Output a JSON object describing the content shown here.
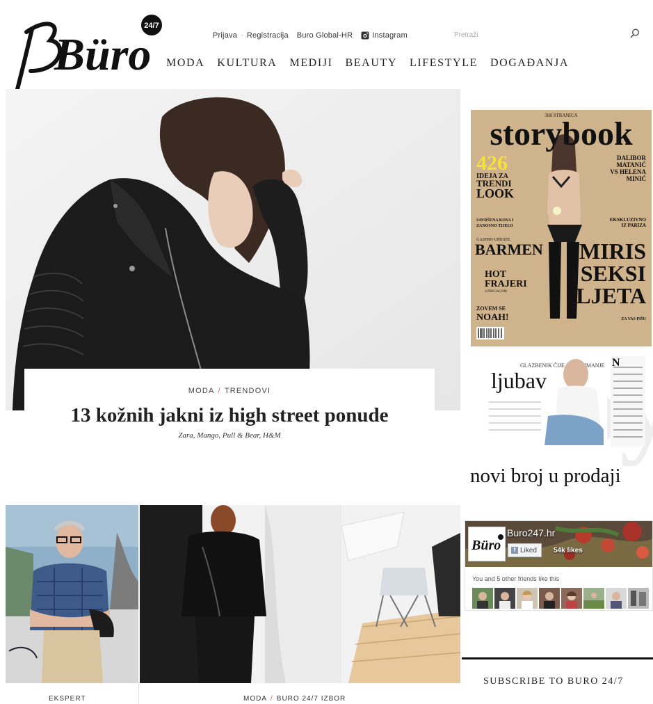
{
  "brand": {
    "logo_text": "Büro",
    "logo_badge": "24/7"
  },
  "top_links": {
    "login": "Prijava",
    "separator": "·",
    "register": "Registracija",
    "global": "Buro Global-HR",
    "instagram": "Instagram"
  },
  "search": {
    "placeholder": "Pretraži",
    "icon": "search-icon"
  },
  "nav": {
    "items": [
      "MODA",
      "KULTURA",
      "MEDIJI",
      "BEAUTY",
      "LIFESTYLE",
      "DOGAĐANJA"
    ]
  },
  "hero": {
    "category": "MODA",
    "separator": "/",
    "subcategory": "TRENDOVI",
    "title": "13 kožnih jakni iz high street ponude",
    "subtitle": "Zara, Mango, Pull & Bear, H&M"
  },
  "cards": [
    {
      "category": "EKSPERT"
    },
    {
      "category": "MODA",
      "separator": "/",
      "subcategory": "BURO 24/7 IZBOR"
    }
  ],
  "magazine": {
    "pages": "308 STRANICA",
    "title": "storybook",
    "big_number": "426",
    "left_lines": [
      "IDEJA ZA",
      "TRENDI",
      "LOOK"
    ],
    "center_line_1": "SAVRŠENA KOSA I",
    "center_line_2": "ZANOSNO TIJELO",
    "barmen_small": "GASTRO UPDATE",
    "barmen": "BARMEN",
    "hot_1": "HOT",
    "hot_2": "FRAJERI",
    "hot_small": "S PREGACOM",
    "noah_1": "ZOVEM SE",
    "noah_2": "NOAH!",
    "right_top_1": "DALIBOR",
    "right_top_2": "MATANIĆ",
    "right_top_3": "VS HELENA",
    "right_top_4": "MINIĆ",
    "right_small": "EKSKLUZIVNO",
    "right_small_2": "IZ PARIZA",
    "miris_1": "MIRIS",
    "miris_2": "SEKSI",
    "miris_3": "LJETA",
    "za_vas": "ZA VAS PIŠU"
  },
  "promo": {
    "headline": "GLAZBENIK ČIJE JE ZANIMANJE",
    "big_word": "ljubav",
    "caption": "novi broj u prodaji"
  },
  "facebook": {
    "page_name": "Buro247.hr",
    "liked_label": "Liked",
    "likes_count": "54k likes",
    "friends_text": "You and 5 other friends like this",
    "faces_count": 8
  },
  "subscribe": {
    "label": "SUBSCRIBE TO BURO 24/7"
  },
  "colors": {
    "accent": "#e06a4a",
    "text": "#222222",
    "magazine_yellow": "#f4e238"
  }
}
